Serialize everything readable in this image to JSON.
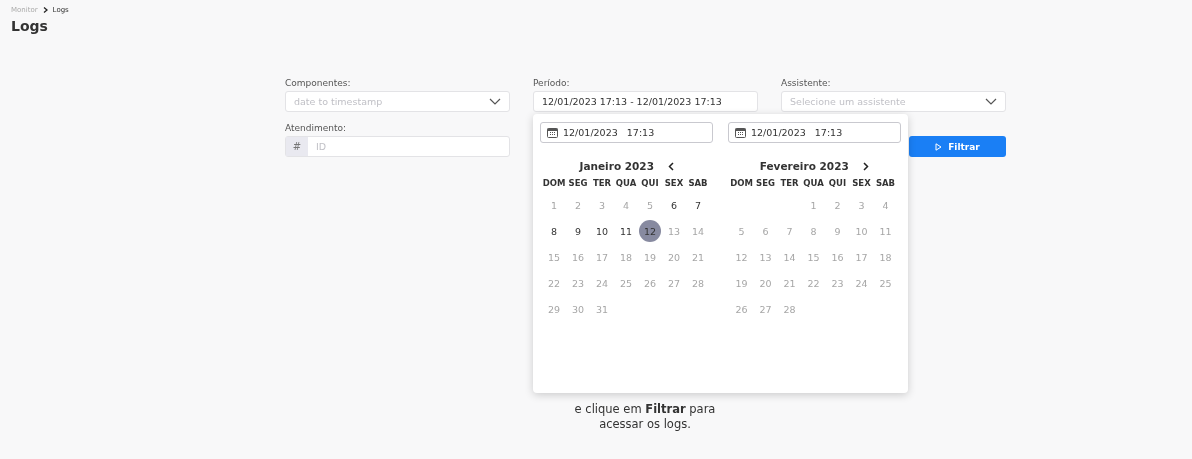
{
  "breadcrumb": [
    {
      "label": "Monitor",
      "selected": false
    },
    {
      "label": "Logs",
      "selected": true
    }
  ],
  "title": "Logs",
  "filters": {
    "componentes": {
      "label": "Componentes:",
      "placeholder": "date to timestamp"
    },
    "periodo": {
      "label": "Período:",
      "value": "12/01/2023 17:13 - 12/01/2023 17:13"
    },
    "assistente": {
      "label": "Assistente:",
      "placeholder": "Selecione um assistente"
    },
    "atendimento": {
      "label": "Atendimento:",
      "prefix": "#",
      "placeholder": "ID"
    },
    "filter_button": "Filtrar"
  },
  "date_picker": {
    "start": "12/01/2023   17:13",
    "end": "12/01/2023   17:13",
    "months": [
      {
        "title": "Janeiro 2023",
        "weekdays": [
          "DOM",
          "SEG",
          "TER",
          "QUA",
          "QUI",
          "SEX",
          "SAB"
        ],
        "weeks": [
          [
            {
              "label": "1",
              "disabled": true,
              "selected": false
            },
            {
              "label": "2",
              "disabled": true,
              "selected": false
            },
            {
              "label": "3",
              "disabled": true,
              "selected": false
            },
            {
              "label": "4",
              "disabled": true,
              "selected": false
            },
            {
              "label": "5",
              "disabled": true,
              "selected": false
            },
            {
              "label": "6",
              "disabled": false,
              "selected": false
            },
            {
              "label": "7",
              "disabled": false,
              "selected": false
            }
          ],
          [
            {
              "label": "8",
              "disabled": false,
              "selected": false
            },
            {
              "label": "9",
              "disabled": false,
              "selected": false
            },
            {
              "label": "10",
              "disabled": false,
              "selected": false
            },
            {
              "label": "11",
              "disabled": false,
              "selected": false
            },
            {
              "label": "12",
              "disabled": false,
              "selected": true
            },
            {
              "label": "13",
              "disabled": true,
              "selected": false
            },
            {
              "label": "14",
              "disabled": true,
              "selected": false
            }
          ],
          [
            {
              "label": "15",
              "disabled": true,
              "selected": false
            },
            {
              "label": "16",
              "disabled": true,
              "selected": false
            },
            {
              "label": "17",
              "disabled": true,
              "selected": false
            },
            {
              "label": "18",
              "disabled": true,
              "selected": false
            },
            {
              "label": "19",
              "disabled": true,
              "selected": false
            },
            {
              "label": "20",
              "disabled": true,
              "selected": false
            },
            {
              "label": "21",
              "disabled": true,
              "selected": false
            }
          ],
          [
            {
              "label": "22",
              "disabled": true,
              "selected": false
            },
            {
              "label": "23",
              "disabled": true,
              "selected": false
            },
            {
              "label": "24",
              "disabled": true,
              "selected": false
            },
            {
              "label": "25",
              "disabled": true,
              "selected": false
            },
            {
              "label": "26",
              "disabled": true,
              "selected": false
            },
            {
              "label": "27",
              "disabled": true,
              "selected": false
            },
            {
              "label": "28",
              "disabled": true,
              "selected": false
            }
          ],
          [
            {
              "label": "29",
              "disabled": true,
              "selected": false
            },
            {
              "label": "30",
              "disabled": true,
              "selected": false
            },
            {
              "label": "31",
              "disabled": true,
              "selected": false
            }
          ]
        ]
      },
      {
        "title": "Fevereiro 2023",
        "weekdays": [
          "DOM",
          "SEG",
          "TER",
          "QUA",
          "QUI",
          "SEX",
          "SAB"
        ],
        "weeks": [
          [
            {
              "label": "1",
              "disabled": true,
              "selected": false
            },
            {
              "label": "2",
              "disabled": true,
              "selected": false
            },
            {
              "label": "3",
              "disabled": true,
              "selected": false
            },
            {
              "label": "4",
              "disabled": true,
              "selected": false
            }
          ],
          [
            {
              "label": "5",
              "disabled": true,
              "selected": false
            },
            {
              "label": "6",
              "disabled": true,
              "selected": false
            },
            {
              "label": "7",
              "disabled": true,
              "selected": false
            },
            {
              "label": "8",
              "disabled": true,
              "selected": false
            },
            {
              "label": "9",
              "disabled": true,
              "selected": false
            },
            {
              "label": "10",
              "disabled": true,
              "selected": false
            },
            {
              "label": "11",
              "disabled": true,
              "selected": false
            }
          ],
          [
            {
              "label": "12",
              "disabled": true,
              "selected": false
            },
            {
              "label": "13",
              "disabled": true,
              "selected": false
            },
            {
              "label": "14",
              "disabled": true,
              "selected": false
            },
            {
              "label": "15",
              "disabled": true,
              "selected": false
            },
            {
              "label": "16",
              "disabled": true,
              "selected": false
            },
            {
              "label": "17",
              "disabled": true,
              "selected": false
            },
            {
              "label": "18",
              "disabled": true,
              "selected": false
            }
          ],
          [
            {
              "label": "19",
              "disabled": true,
              "selected": false
            },
            {
              "label": "20",
              "disabled": true,
              "selected": false
            },
            {
              "label": "21",
              "disabled": true,
              "selected": false
            },
            {
              "label": "22",
              "disabled": true,
              "selected": false
            },
            {
              "label": "23",
              "disabled": true,
              "selected": false
            },
            {
              "label": "24",
              "disabled": true,
              "selected": false
            },
            {
              "label": "25",
              "disabled": true,
              "selected": false
            }
          ],
          [
            {
              "label": "26",
              "disabled": true,
              "selected": false
            },
            {
              "label": "27",
              "disabled": true,
              "selected": false
            },
            {
              "label": "28",
              "disabled": true,
              "selected": false
            }
          ]
        ]
      }
    ]
  },
  "empty_message": "e clique em **Filtrar** para acessar os logs."
}
